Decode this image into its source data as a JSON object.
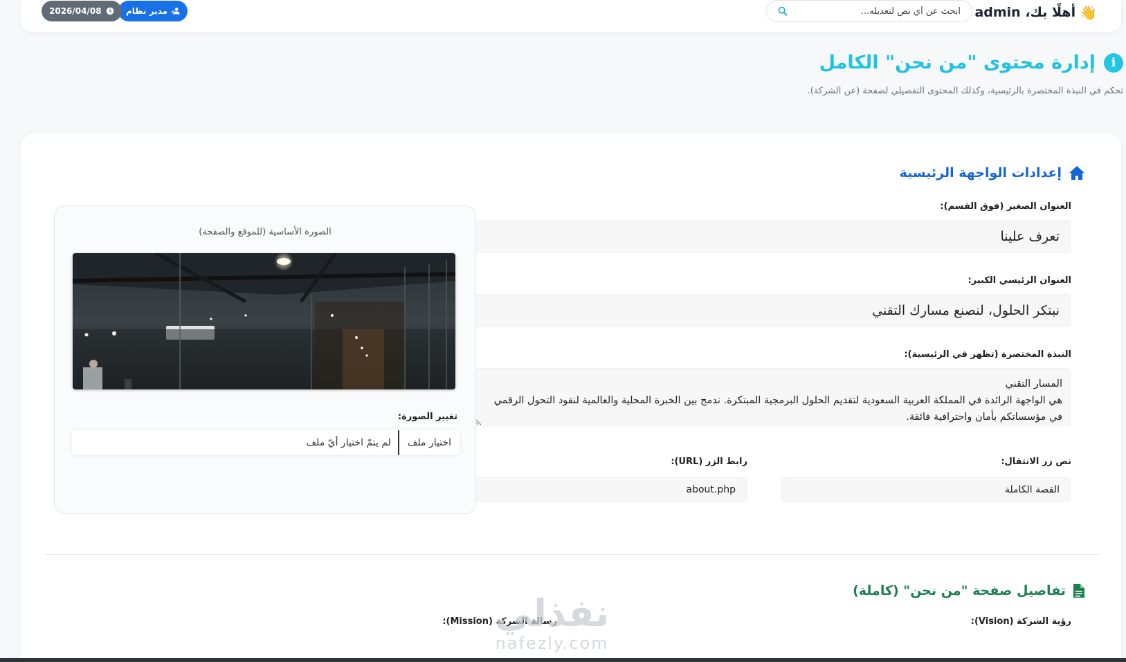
{
  "header": {
    "welcome": "أهلًا بك، admin",
    "search_placeholder": "ابحث عن أي نص لتعديله...",
    "role_badge": "مدير نظام",
    "date_badge": "2026/04/08"
  },
  "page": {
    "title": "إدارة محتوى \"من نحن\" الكامل",
    "subtitle": "تحكم في النبذة المختصرة بالرئيسية، وكذلك المحتوى التفصيلي لصفحة (عن الشركة)."
  },
  "home_settings": {
    "title": "إعدادات الواجهة الرئيسية",
    "small_title_label": "العنوان الصغير (فوق القسم):",
    "small_title_value": "تعرف علينا",
    "main_title_label": "العنوان الرئيسي الكبير:",
    "main_title_value": "نبتكر الحلول، لنصنع مسارك التقني",
    "brief_label": "النبذة المختصرة (تظهر في الرئيسية):",
    "brief_value": "المسار التقني\nهي الواجهة الرائدة في المملكة العربية السعودية لتقديم الحلول البرمجية المبتكرة. ندمج بين الخبرة المحلية والعالمية لنقود التحول الرقمي في مؤسساتكم بأمان واحترافية فائقة.",
    "button_text_label": "نص زر الانتقال:",
    "button_text_value": "القصة الكاملة",
    "button_url_label": "رابط الزر (URL):",
    "button_url_value": "about.php"
  },
  "image_panel": {
    "caption": "الصورة الأساسية (للموقع والصفحة)",
    "change_label": "تغيير الصورة:",
    "file_button": "اختيار ملف",
    "file_status": "لم يتمّ اختيار أيّ ملف"
  },
  "page_details": {
    "title": "تفاصيل صفحة \"من نحن\" (كاملة)",
    "vision_label": "رؤية الشركة (Vision):",
    "mission_label": "رسالة الشركة (Mission):"
  },
  "watermark": {
    "arabic": "نفذلي",
    "latin": "nafezly.com"
  },
  "colors": {
    "accent_cyan": "#22c2e0",
    "accent_blue": "#1565d8",
    "accent_green": "#1a8050",
    "role_badge": "#1971e8",
    "date_badge": "#616b75"
  }
}
